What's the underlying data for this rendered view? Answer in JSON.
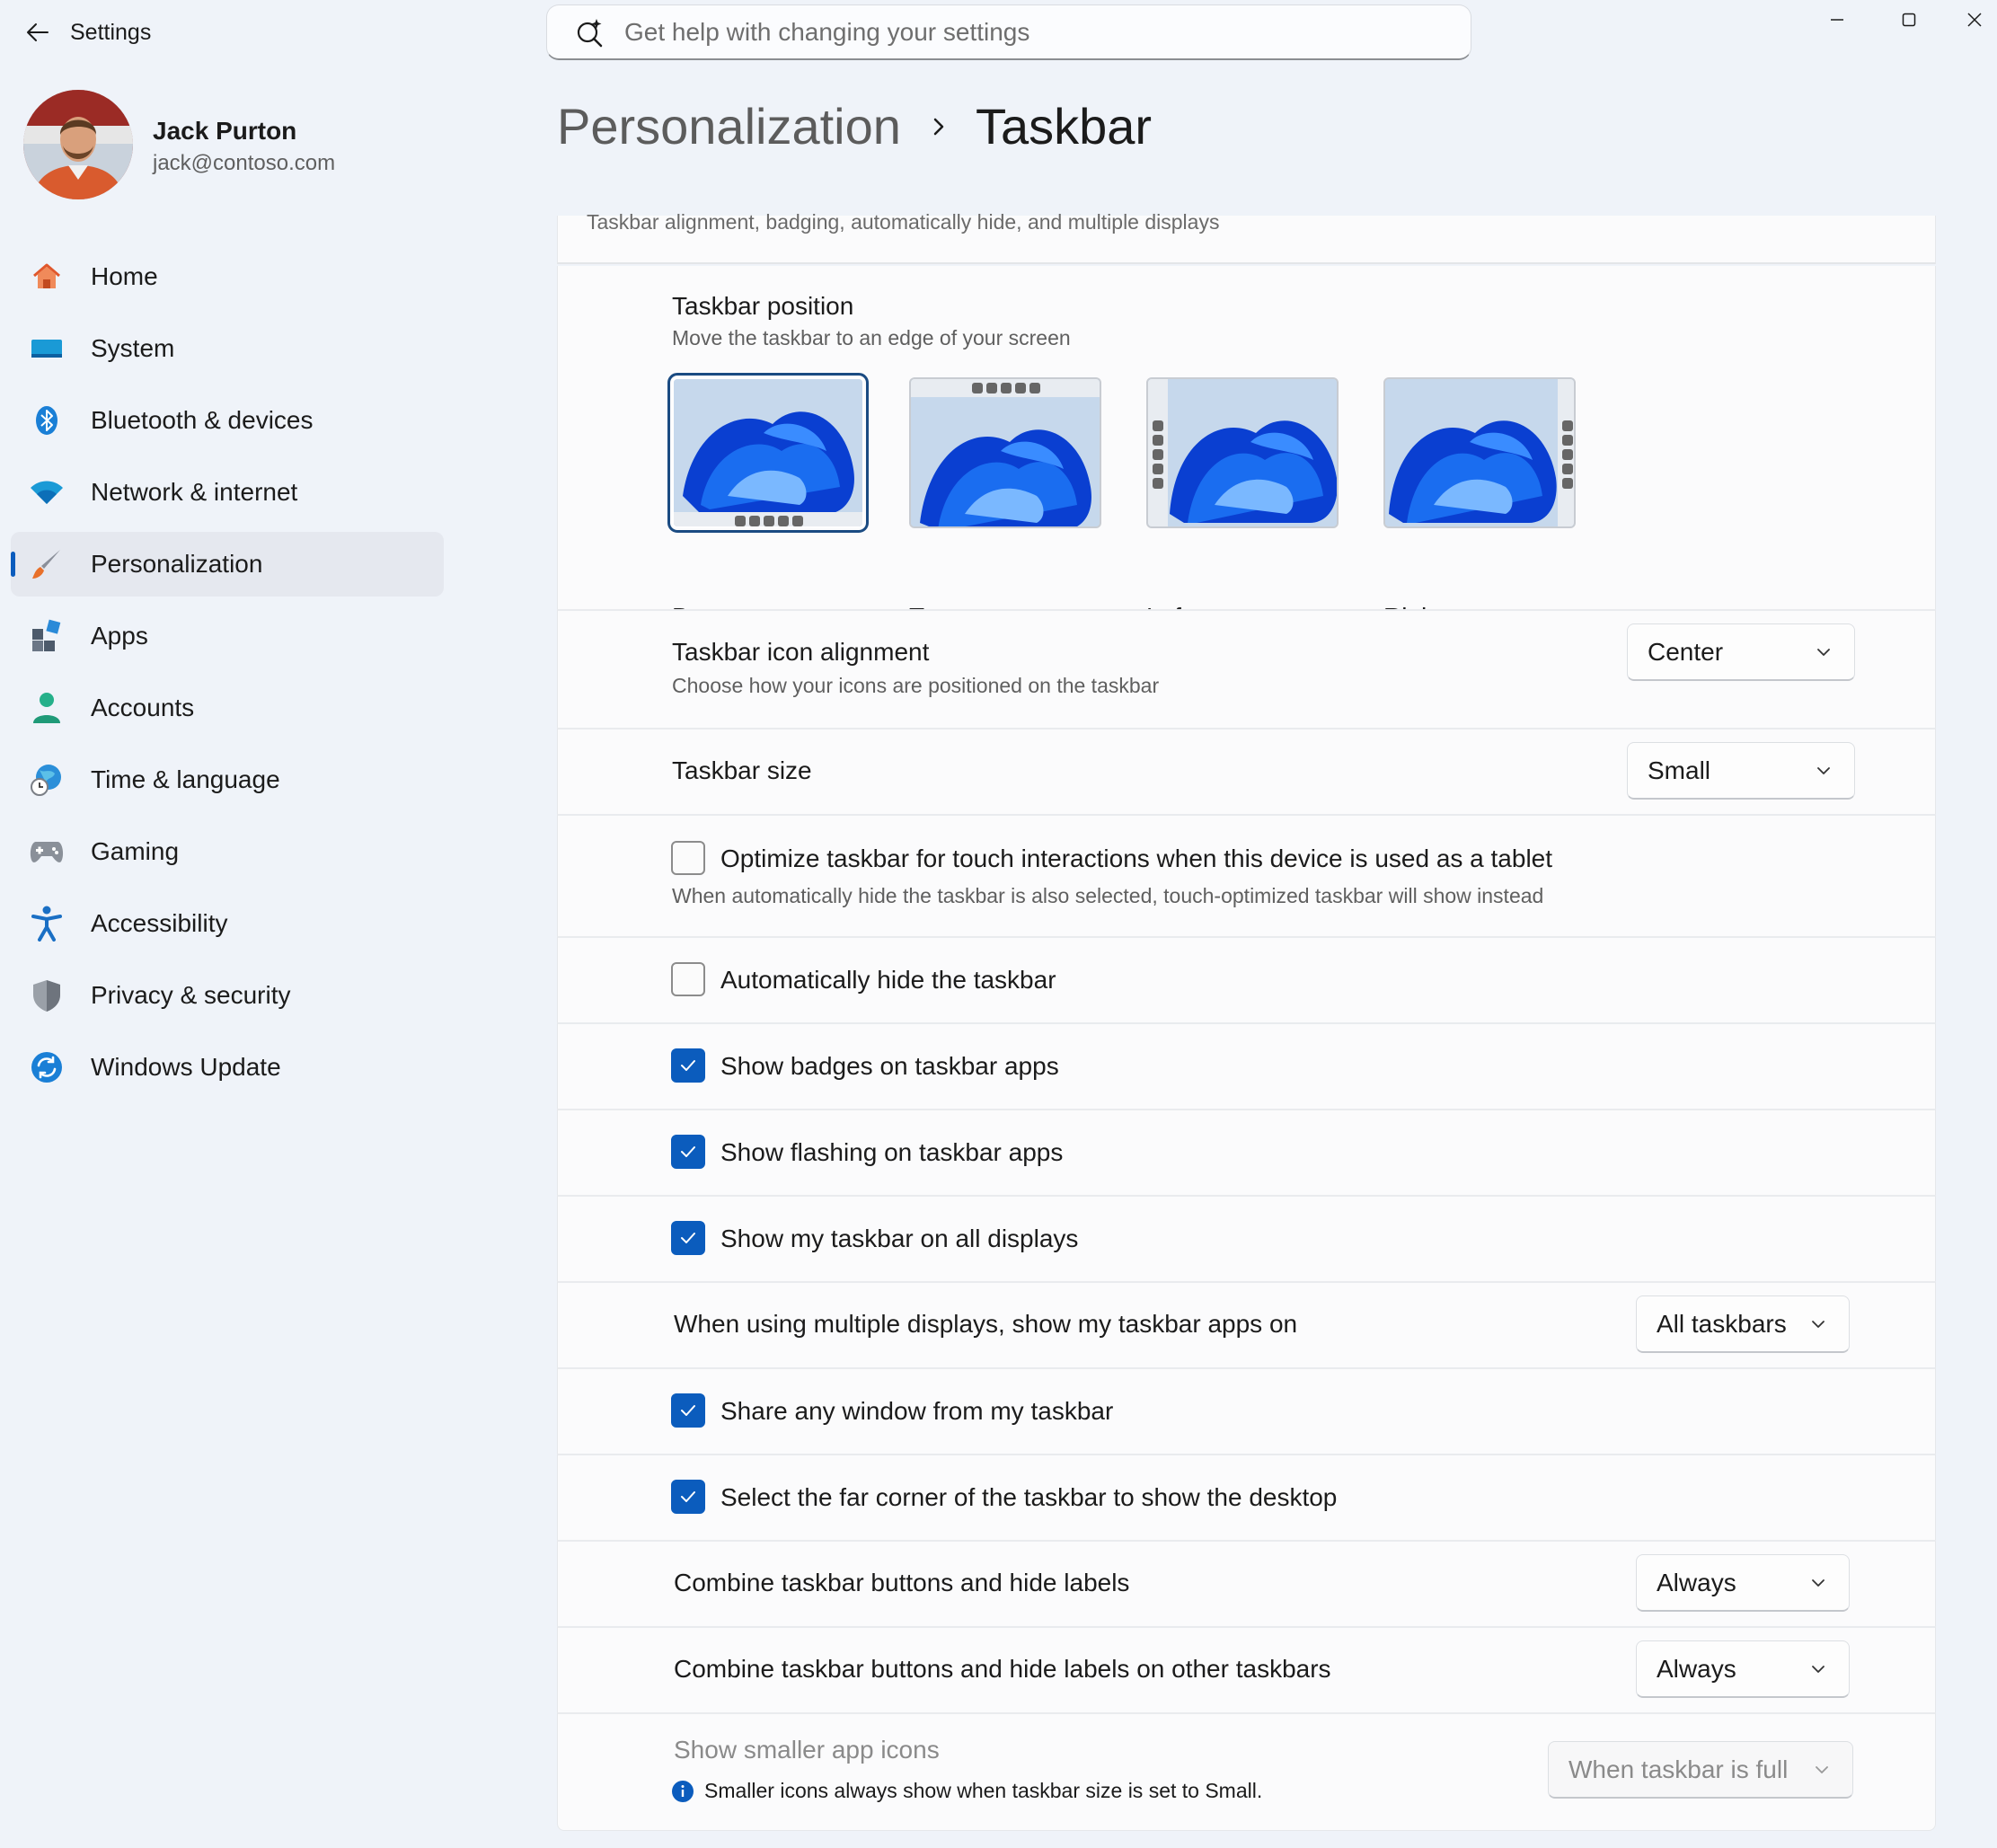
{
  "window": {
    "title": "Settings"
  },
  "search": {
    "placeholder": "Get help with changing your settings"
  },
  "user": {
    "name": "Jack Purton",
    "email": "jack@contoso.com"
  },
  "nav": {
    "items": [
      {
        "label": "Home",
        "icon": "home-icon"
      },
      {
        "label": "System",
        "icon": "system-icon"
      },
      {
        "label": "Bluetooth & devices",
        "icon": "bluetooth-icon"
      },
      {
        "label": "Network & internet",
        "icon": "wifi-icon"
      },
      {
        "label": "Personalization",
        "icon": "brush-icon",
        "selected": true
      },
      {
        "label": "Apps",
        "icon": "apps-icon"
      },
      {
        "label": "Accounts",
        "icon": "person-icon"
      },
      {
        "label": "Time & language",
        "icon": "globe-clock-icon"
      },
      {
        "label": "Gaming",
        "icon": "gamepad-icon"
      },
      {
        "label": "Accessibility",
        "icon": "accessibility-icon"
      },
      {
        "label": "Privacy & security",
        "icon": "shield-icon"
      },
      {
        "label": "Windows Update",
        "icon": "update-icon"
      }
    ]
  },
  "breadcrumb": {
    "parent": "Personalization",
    "current": "Taskbar"
  },
  "section_header": {
    "subtitle": "Taskbar alignment, badging, automatically hide, and multiple displays"
  },
  "taskbar_position": {
    "title": "Taskbar position",
    "subtitle": "Move the taskbar to an edge of your screen",
    "options": [
      {
        "label": "Bottom",
        "selected": true
      },
      {
        "label": "Top",
        "selected": false
      },
      {
        "label": "Left",
        "selected": false
      },
      {
        "label": "Right",
        "selected": false
      }
    ]
  },
  "icon_alignment": {
    "title": "Taskbar icon alignment",
    "subtitle": "Choose how your icons are positioned on the taskbar",
    "value": "Center"
  },
  "taskbar_size": {
    "title": "Taskbar size",
    "value": "Small"
  },
  "touch_optimize": {
    "label": "Optimize taskbar for touch interactions when this device is used as a tablet",
    "subtitle": "When automatically hide the taskbar is also selected, touch-optimized taskbar will show instead",
    "checked": false
  },
  "auto_hide": {
    "label": "Automatically hide the taskbar",
    "checked": false
  },
  "show_badges": {
    "label": "Show badges on taskbar apps",
    "checked": true
  },
  "show_flashing": {
    "label": "Show flashing on taskbar apps",
    "checked": true
  },
  "all_displays": {
    "label": "Show my taskbar on all displays",
    "checked": true
  },
  "multi_display_apps": {
    "title": "When using multiple displays, show my taskbar apps on",
    "value": "All taskbars"
  },
  "share_window": {
    "label": "Share any window from my taskbar",
    "checked": true
  },
  "far_corner": {
    "label": "Select the far corner of the taskbar to show the desktop",
    "checked": true
  },
  "combine_buttons": {
    "title": "Combine taskbar buttons and hide labels",
    "value": "Always"
  },
  "combine_other": {
    "title": "Combine taskbar buttons and hide labels on other taskbars",
    "value": "Always"
  },
  "smaller_icons": {
    "title": "Show smaller app icons",
    "info": "Smaller icons always show when taskbar size is set to Small.",
    "value": "When taskbar is full",
    "disabled": true
  },
  "colors": {
    "accent": "#0b5cbd",
    "background": "#eff3f9",
    "card": "#fbfbfc"
  }
}
